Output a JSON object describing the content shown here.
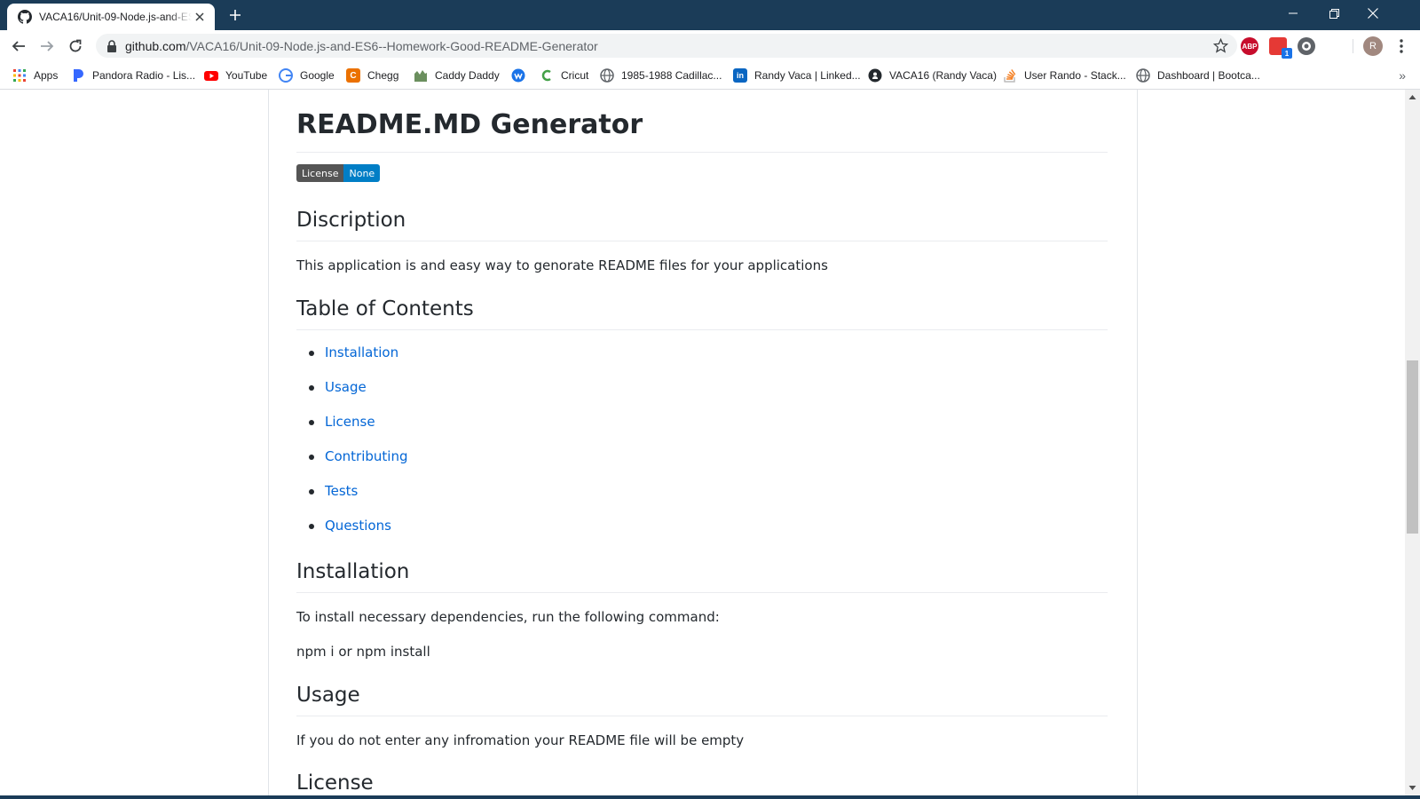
{
  "browser": {
    "tab": {
      "title": "VACA16/Unit-09-Node.js-and-ES6--Homework-Good-README-Generator"
    },
    "address": {
      "host": "github.com",
      "path": "/VACA16/Unit-09-Node.js-and-ES6--Homework-Good-README-Generator"
    },
    "profile_initial": "R",
    "extensions": [
      {
        "name": "adblock-plus-icon",
        "label": "ABP",
        "color": "#c70d2c"
      },
      {
        "name": "extension-badge-icon",
        "label": "1",
        "color": "#1a73e8"
      }
    ],
    "bookmarks": [
      {
        "label": "Apps",
        "icon": "apps-grid-icon",
        "color": "#ea4335"
      },
      {
        "label": "Pandora Radio - Lis...",
        "icon": "pandora-icon",
        "color": "#3668ff"
      },
      {
        "label": "YouTube",
        "icon": "youtube-icon",
        "color": "#ff0000"
      },
      {
        "label": "Google",
        "icon": "google-icon",
        "color": "#4285f4"
      },
      {
        "label": "Chegg",
        "icon": "chegg-icon",
        "color": "#eb7100"
      },
      {
        "label": "Caddy Daddy",
        "icon": "caddy-daddy-icon",
        "color": "#6b8f5e"
      },
      {
        "label": "",
        "icon": "wayback-icon",
        "color": "#1a73e8"
      },
      {
        "label": "Cricut",
        "icon": "cricut-icon",
        "color": "#43a047"
      },
      {
        "label": "1985-1988 Cadillac...",
        "icon": "globe-icon",
        "color": "#5f6368"
      },
      {
        "label": "Randy Vaca | Linked...",
        "icon": "linkedin-icon",
        "color": "#0a66c2"
      },
      {
        "label": "VACA16 (Randy Vaca)",
        "icon": "github-icon",
        "color": "#24292e"
      },
      {
        "label": "User Rando - Stack...",
        "icon": "stackoverflow-icon",
        "color": "#f48024"
      },
      {
        "label": "Dashboard | Bootca...",
        "icon": "globe-icon",
        "color": "#5f6368"
      }
    ]
  },
  "readme": {
    "title": "README.MD Generator",
    "badge": {
      "label": "License",
      "value": "None"
    },
    "sections": {
      "description": {
        "heading": "Discription",
        "text": "This application is and easy way to genorate README files for your applications"
      },
      "toc": {
        "heading": "Table of Contents",
        "items": [
          "Installation",
          "Usage",
          "License",
          "Contributing",
          "Tests",
          "Questions"
        ]
      },
      "installation": {
        "heading": "Installation",
        "text": "To install necessary dependencies, run the following command:",
        "command": "npm i or npm install"
      },
      "usage": {
        "heading": "Usage",
        "text": "If you do not enter any infromation your README file will be empty"
      },
      "license": {
        "heading": "License"
      }
    }
  },
  "colors": {
    "tabstrip": "#1b3c58",
    "link": "#0366d6",
    "text": "#24292e"
  }
}
